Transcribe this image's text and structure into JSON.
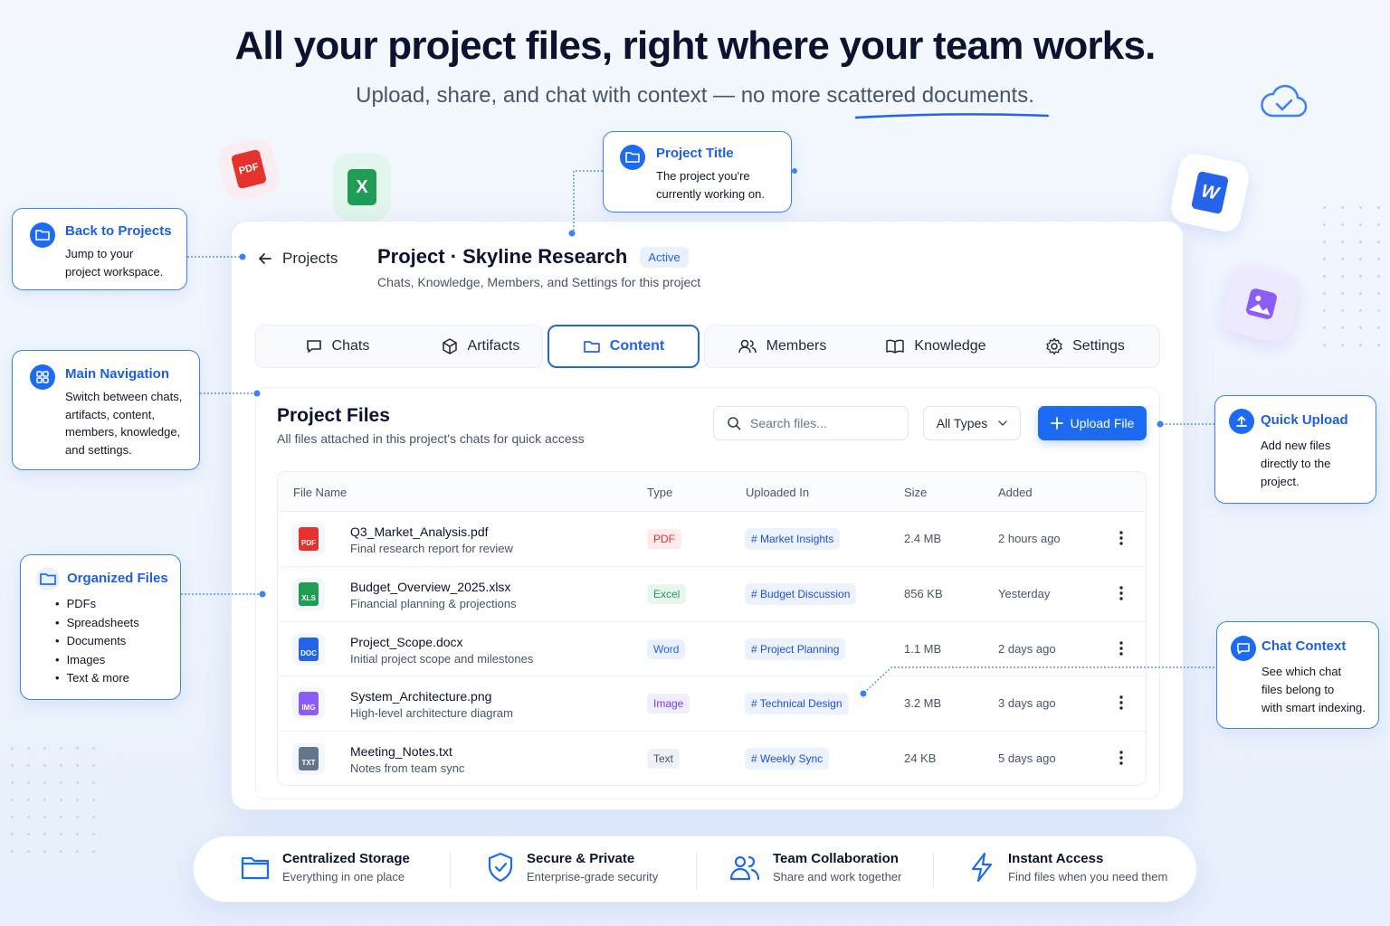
{
  "hero": {
    "title": "All your project files, right where your team works.",
    "subtitle": "Upload, share, and chat with context — no more scattered documents."
  },
  "header": {
    "back_label": "Projects",
    "project_title": "Project · Skyline Research",
    "status_badge": "Active",
    "project_subtitle": "Chats, Knowledge, Members, and Settings for this project"
  },
  "tabs": [
    {
      "label": "Chats",
      "icon": "chat-bubble-icon"
    },
    {
      "label": "Artifacts",
      "icon": "cube-icon"
    },
    {
      "label": "Content",
      "icon": "folder-icon",
      "active": true
    },
    {
      "label": "Members",
      "icon": "users-icon"
    },
    {
      "label": "Knowledge",
      "icon": "book-icon"
    },
    {
      "label": "Settings",
      "icon": "gear-icon"
    }
  ],
  "files_panel": {
    "title": "Project Files",
    "subtitle": "All files attached in this project's chats for quick access",
    "search_placeholder": "Search files...",
    "type_filter": "All Types",
    "upload_label": "Upload File",
    "columns": [
      "File Name",
      "Type",
      "Uploaded In",
      "Size",
      "Added"
    ],
    "rows": [
      {
        "name": "Q3_Market_Analysis.pdf",
        "desc": "Final research report for review",
        "type": "PDF",
        "chat": "# Market Insights",
        "size": "2.4 MB",
        "added": "2 hours ago",
        "icon_label": "PDF"
      },
      {
        "name": "Budget_Overview_2025.xlsx",
        "desc": "Financial planning & projections",
        "type": "Excel",
        "chat": "# Budget Discussion",
        "size": "856 KB",
        "added": "Yesterday",
        "icon_label": "XLS"
      },
      {
        "name": "Project_Scope.docx",
        "desc": "Initial project scope and milestones",
        "type": "Word",
        "chat": "# Project Planning",
        "size": "1.1 MB",
        "added": "2 days ago",
        "icon_label": "DOC"
      },
      {
        "name": "System_Architecture.png",
        "desc": "High-level architecture diagram",
        "type": "Image",
        "chat": "# Technical Design",
        "size": "3.2 MB",
        "added": "3 days ago",
        "icon_label": "IMG"
      },
      {
        "name": "Meeting_Notes.txt",
        "desc": "Notes from team sync",
        "type": "Text",
        "chat": "# Weekly Sync",
        "size": "24 KB",
        "added": "5 days ago",
        "icon_label": "TXT"
      }
    ]
  },
  "callouts": {
    "project_title": {
      "title": "Project Title",
      "body": [
        "The project you're",
        "currently working on."
      ]
    },
    "back": {
      "title": "Back to Projects",
      "body": [
        "Jump to your",
        "project workspace."
      ]
    },
    "nav": {
      "title": "Main Navigation",
      "body": [
        "Switch between chats,",
        "artifacts, content,",
        "members, knowledge,",
        "and settings."
      ]
    },
    "organized": {
      "title": "Organized Files",
      "items": [
        "PDFs",
        "Spreadsheets",
        "Documents",
        "Images",
        "Text & more"
      ]
    },
    "upload": {
      "title": "Quick Upload",
      "body": [
        "Add new files",
        "directly to the",
        "project."
      ]
    },
    "chat": {
      "title": "Chat Context",
      "body": [
        "See which chat",
        "files belong to",
        "with smart indexing."
      ]
    }
  },
  "features": [
    {
      "title": "Centralized Storage",
      "sub": "Everything in one place",
      "icon": "folder-icon"
    },
    {
      "title": "Secure & Private",
      "sub": "Enterprise-grade security",
      "icon": "shield-check-icon"
    },
    {
      "title": "Team Collaboration",
      "sub": "Share and work together",
      "icon": "users-icon"
    },
    {
      "title": "Instant Access",
      "sub": "Find files when you need them",
      "icon": "lightning-icon"
    }
  ],
  "floating_icons": {
    "pdf": "PDF",
    "excel": "X",
    "word": "W"
  },
  "colors": {
    "accent": "#1d6bf3",
    "pdf": "#e5322d",
    "excel": "#1f9d55",
    "word": "#2563eb",
    "image": "#8b5cf6",
    "text": "#475569"
  }
}
